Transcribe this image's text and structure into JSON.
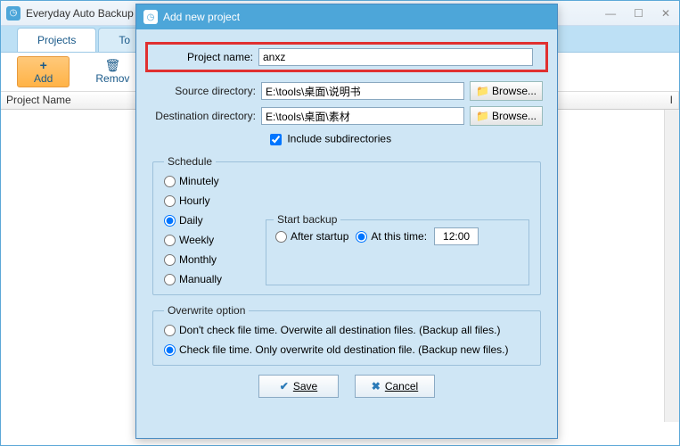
{
  "mainWindow": {
    "title": "Everyday Auto Backup",
    "tabs": {
      "projects": "Projects",
      "tools": "To"
    },
    "toolbar": {
      "add": "Add",
      "remove": "Remov"
    },
    "grid": {
      "header_project_name": "Project Name",
      "header_i": "I"
    }
  },
  "dialog": {
    "title": "Add new project",
    "labels": {
      "project_name": "Project name:",
      "source_dir": "Source directory:",
      "dest_dir": "Destination directory:",
      "include_sub": "Include subdirectories",
      "browse": "Browse..."
    },
    "values": {
      "project_name": "anxz",
      "source_dir": "E:\\tools\\桌面\\说明书",
      "dest_dir": "E:\\tools\\桌面\\素材",
      "include_sub_checked": true
    },
    "schedule": {
      "legend": "Schedule",
      "options": {
        "minutely": "Minutely",
        "hourly": "Hourly",
        "daily": "Daily",
        "weekly": "Weekly",
        "monthly": "Monthly",
        "manually": "Manually"
      },
      "selected": "daily",
      "start_backup": {
        "legend": "Start backup",
        "after_startup": "After startup",
        "at_this_time": "At this time:",
        "selected": "at_this_time",
        "time": "12:00"
      }
    },
    "overwrite": {
      "legend": "Overwrite option",
      "opt1": "Don't check file time. Overwite all destination files. (Backup all files.)",
      "opt2": "Check file time. Only overwrite old destination file. (Backup new files.)",
      "selected": "opt2"
    },
    "buttons": {
      "save": "Save",
      "cancel": "Cancel"
    }
  }
}
